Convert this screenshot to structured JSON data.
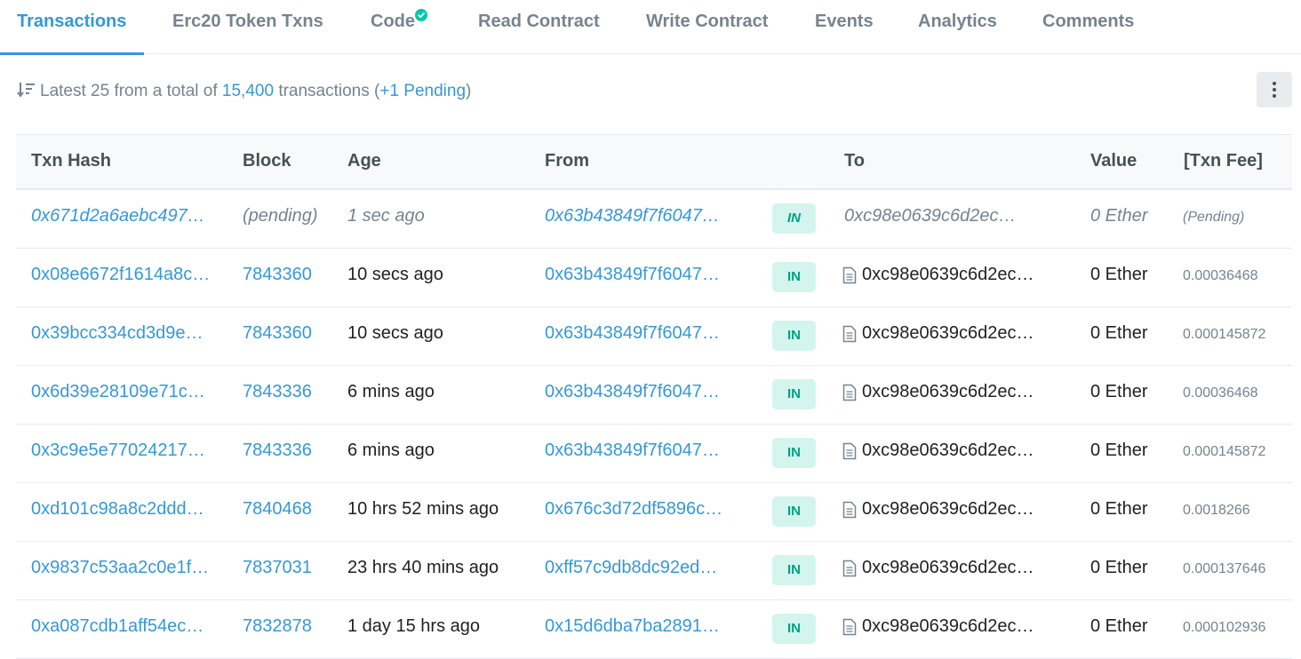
{
  "tabs": [
    {
      "label": "Transactions",
      "active": true
    },
    {
      "label": "Erc20 Token Txns"
    },
    {
      "label": "Code",
      "verified_icon": "check-circle-icon"
    },
    {
      "label": "Read Contract"
    },
    {
      "label": "Write Contract"
    },
    {
      "label": "Events"
    },
    {
      "label": "Analytics"
    },
    {
      "label": "Comments"
    }
  ],
  "summary": {
    "sort_icon": "sort-descending-icon",
    "prefix": "Latest 25 from a total of",
    "total": "15,400",
    "middle": "transactions (",
    "pending": "+1 Pending",
    "suffix": ")"
  },
  "more_icon": "vertical-dots-icon",
  "table": {
    "headers": [
      "Txn Hash",
      "Block",
      "Age",
      "From",
      "To",
      "Value",
      "[Txn Fee]"
    ],
    "rows": [
      {
        "hash": "0x671d2a6aebc497…",
        "block": "(pending)",
        "age": "1 sec ago",
        "from": "0x63b43849f7f6047…",
        "dir": "IN",
        "to": "0xc98e0639c6d2ec…",
        "value": "0 Ether",
        "fee": "(Pending)",
        "pending": true
      },
      {
        "hash": "0x08e6672f1614a8c…",
        "block": "7843360",
        "age": "10 secs ago",
        "from": "0x63b43849f7f6047…",
        "dir": "IN",
        "to": "0xc98e0639c6d2ec…",
        "value": "0 Ether",
        "fee": "0.00036468"
      },
      {
        "hash": "0x39bcc334cd3d9e…",
        "block": "7843360",
        "age": "10 secs ago",
        "from": "0x63b43849f7f6047…",
        "dir": "IN",
        "to": "0xc98e0639c6d2ec…",
        "value": "0 Ether",
        "fee": "0.000145872"
      },
      {
        "hash": "0x6d39e28109e71c…",
        "block": "7843336",
        "age": "6 mins ago",
        "from": "0x63b43849f7f6047…",
        "dir": "IN",
        "to": "0xc98e0639c6d2ec…",
        "value": "0 Ether",
        "fee": "0.00036468"
      },
      {
        "hash": "0x3c9e5e77024217…",
        "block": "7843336",
        "age": "6 mins ago",
        "from": "0x63b43849f7f6047…",
        "dir": "IN",
        "to": "0xc98e0639c6d2ec…",
        "value": "0 Ether",
        "fee": "0.000145872"
      },
      {
        "hash": "0xd101c98a8c2ddd…",
        "block": "7840468",
        "age": "10 hrs 52 mins ago",
        "from": "0x676c3d72df5896c…",
        "dir": "IN",
        "to": "0xc98e0639c6d2ec…",
        "value": "0 Ether",
        "fee": "0.0018266"
      },
      {
        "hash": "0x9837c53aa2c0e1f…",
        "block": "7837031",
        "age": "23 hrs 40 mins ago",
        "from": "0xff57c9db8dc92ed…",
        "dir": "IN",
        "to": "0xc98e0639c6d2ec…",
        "value": "0 Ether",
        "fee": "0.000137646"
      },
      {
        "hash": "0xa087cdb1aff54ec…",
        "block": "7832878",
        "age": "1 day 15 hrs ago",
        "from": "0x15d6dba7ba2891…",
        "dir": "IN",
        "to": "0xc98e0639c6d2ec…",
        "value": "0 Ether",
        "fee": "0.000102936"
      }
    ]
  },
  "colors": {
    "accent": "#3498db",
    "in_badge_bg": "#d3f5ee",
    "in_badge_text": "#00a186",
    "verified": "#00c9a7"
  }
}
